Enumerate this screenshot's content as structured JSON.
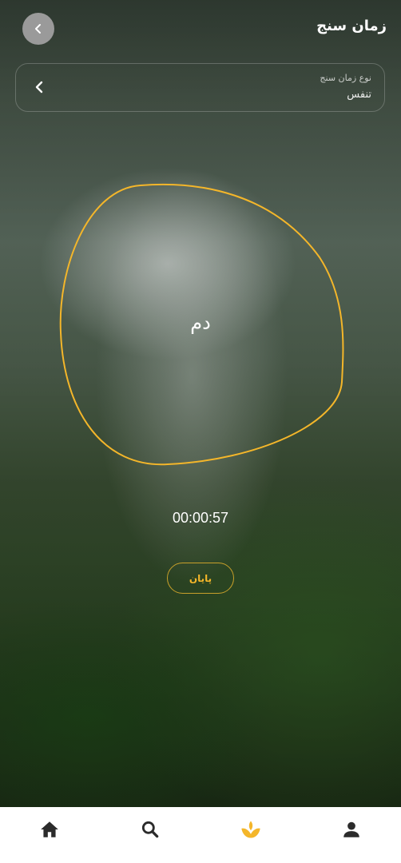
{
  "header": {
    "title": "زمان سنج",
    "back_icon": "chevron-left-icon"
  },
  "timer_type": {
    "label": "نوع زمان سنج",
    "value": "تنفس",
    "chevron_icon": "chevron-left-icon"
  },
  "breathing": {
    "phase": "دم",
    "ring_color": "#f4b62a"
  },
  "timer": {
    "elapsed": "00:00:57"
  },
  "actions": {
    "end_label": "پایان",
    "accent": "#f4b62a"
  },
  "bottom_nav": {
    "items": [
      {
        "icon": "home-icon",
        "active": false
      },
      {
        "icon": "search-icon",
        "active": false
      },
      {
        "icon": "lotus-icon",
        "active": true
      },
      {
        "icon": "profile-icon",
        "active": false
      }
    ],
    "active_color": "#f4b62a",
    "icon_color": "#2b2b2b"
  }
}
